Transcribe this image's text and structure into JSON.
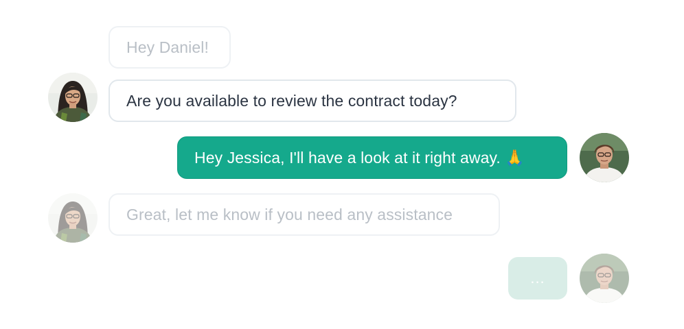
{
  "conversation": {
    "messages": [
      {
        "sender": "Jessica",
        "text": "Hey Daniel!"
      },
      {
        "sender": "Jessica",
        "text": "Are you available to review the contract today?"
      },
      {
        "sender": "Daniel",
        "text": "Hey Jessica, I'll have a look at it right away. 🙏"
      },
      {
        "sender": "Jessica",
        "text": "Great, let me know if you need any assistance"
      },
      {
        "sender": "Daniel",
        "text": "..."
      }
    ]
  },
  "colors": {
    "outgoing_bubble": "#15a98c",
    "incoming_border": "#e1e7ec",
    "typing_bubble": "#d9ede7",
    "incoming_text": "#2b3442",
    "faded_text": "#b9bfc6"
  },
  "icons": {
    "jessica_avatar": "woman-portrait-avatar",
    "daniel_avatar": "man-portrait-avatar",
    "emoji": "folded-hands-emoji"
  }
}
